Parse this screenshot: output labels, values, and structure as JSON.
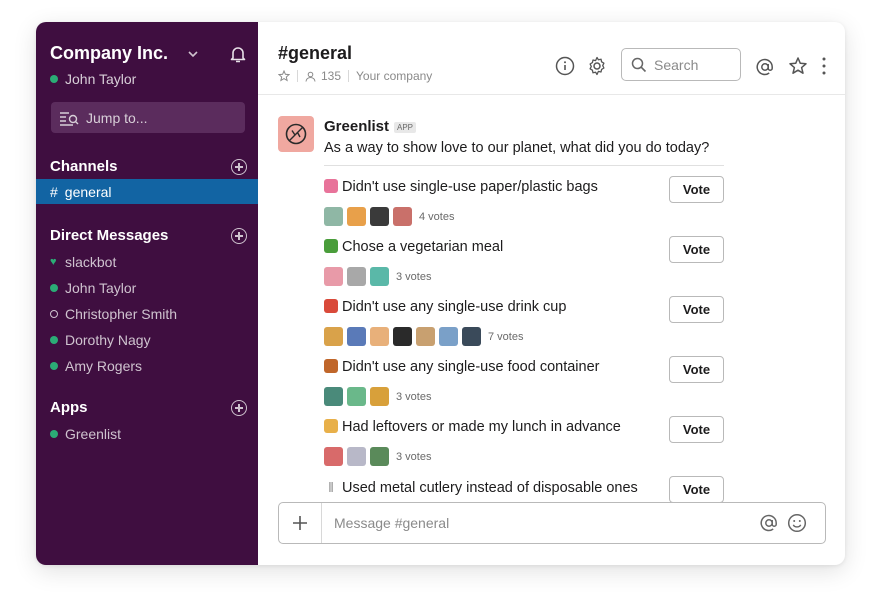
{
  "workspace": {
    "name": "Company Inc.",
    "user": "John Taylor"
  },
  "sidebar": {
    "jump_placeholder": "Jump to...",
    "channels_title": "Channels",
    "active_channel": "general",
    "dm_title": "Direct Messages",
    "dms": [
      {
        "name": "slackbot",
        "status": "heart"
      },
      {
        "name": "John Taylor",
        "status": "online"
      },
      {
        "name": "Christopher Smith",
        "status": "away"
      },
      {
        "name": "Dorothy Nagy",
        "status": "online"
      },
      {
        "name": "Amy Rogers",
        "status": "online"
      }
    ],
    "apps_title": "Apps",
    "apps": [
      {
        "name": "Greenlist",
        "status": "online"
      }
    ]
  },
  "header": {
    "channel": "#general",
    "members": "135",
    "description": "Your company",
    "search_placeholder": "Search"
  },
  "message": {
    "app_name": "Greenlist",
    "badge": "APP",
    "question": "As a way to show love to our planet, what did you do today?",
    "vote_label": "Vote",
    "options": [
      {
        "text": "Didn't use single-use paper/plastic bags",
        "votes": "4 votes",
        "emoji_color": "#f2a33a"
      },
      {
        "text": "Chose a vegetarian meal",
        "votes": "3 votes",
        "emoji_color": "#4a9d3b"
      },
      {
        "text": "Didn't use any single-use drink cup",
        "votes": "7 votes",
        "emoji_color": "#d94a3a"
      },
      {
        "text": "Didn't use any single-use food container",
        "votes": "3 votes",
        "emoji_color": "#c0662a"
      },
      {
        "text": "Had leftovers or made my lunch in advance",
        "votes": "3 votes",
        "emoji_color": "#e8b04a"
      },
      {
        "text": "Used metal cutlery instead of disposable ones",
        "votes": "",
        "emoji_color": "#9a9a9a"
      }
    ]
  },
  "composer": {
    "placeholder": "Message #general"
  },
  "colors": {
    "sidebar": "#3f0e40",
    "active": "#1264a3",
    "online": "#2bac76"
  }
}
